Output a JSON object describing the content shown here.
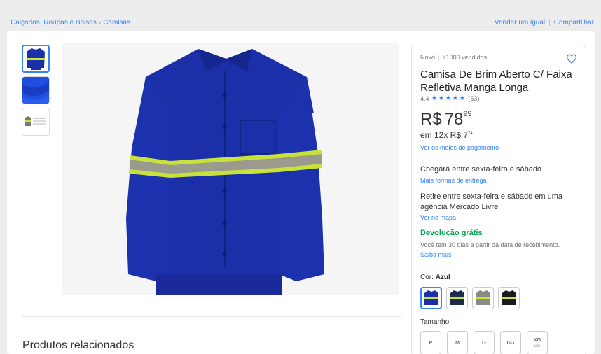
{
  "breadcrumb": {
    "items": [
      "Calçados, Roupas e Bolsas",
      "Camisas"
    ],
    "separator": "›"
  },
  "top_actions": {
    "sell": "Vender um igual",
    "share": "Compartilhar"
  },
  "product": {
    "condition": "Novo",
    "sold": "+1000 vendidos",
    "title": "Camisa De Brim Aberto C/ Faixa Refletiva Manga Longa",
    "rating": {
      "value": "4.4",
      "stars": "★★★★★",
      "count": "(53)"
    },
    "price": {
      "currency": "R$",
      "integer": "78",
      "cents": "99"
    },
    "installments": {
      "text": "em 12x R$ 7",
      "cents": "74"
    },
    "payment_link": "Ver os meios de pagamento"
  },
  "shipping": {
    "arrival": "Chegará entre sexta-feira e sábado",
    "more_link": "Mais formas de entrega",
    "pickup": "Retire entre sexta-feira e sábado em uma agência Mercado Livre",
    "map_link": "Ver no mapa"
  },
  "returns": {
    "title": "Devolução grátis",
    "desc": "Você tem 30 dias a partir da data de recebimento.",
    "link": "Saiba mais"
  },
  "variations": {
    "color_label": "Cor:",
    "color_value": "Azul",
    "swatches": [
      {
        "name": "Azul royal",
        "color": "#1a2fa8"
      },
      {
        "name": "Marinho",
        "color": "#1b2a4d"
      },
      {
        "name": "Cinza",
        "color": "#8a8a84"
      },
      {
        "name": "Preto",
        "color": "#1a1a1a"
      }
    ],
    "size_label": "Tamanho:",
    "sizes": [
      {
        "label": "P",
        "sub": ""
      },
      {
        "label": "M",
        "sub": ""
      },
      {
        "label": "G",
        "sub": ""
      },
      {
        "label": "GG",
        "sub": ""
      },
      {
        "label": "XG",
        "sub": "GG"
      }
    ]
  },
  "related": {
    "title": "Produtos relacionados"
  },
  "colors": {
    "accent": "#3483fa",
    "green": "#00a650",
    "shirt": "#1a2fa8",
    "reflective": "#c9e23a"
  }
}
